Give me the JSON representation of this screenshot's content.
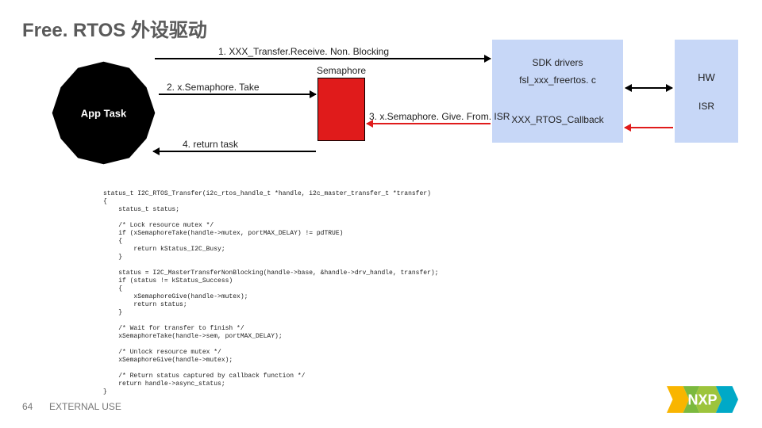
{
  "title": "Free. RTOS 外设驱动",
  "appTask": "App Task",
  "semaphore": "Semaphore",
  "step1": "1.  XXX_Transfer.Receive. Non. Blocking",
  "step2": "2. x.Semaphore. Take",
  "step3": "3. x.Semaphore. Give. From. ISR",
  "step4": "4. return task",
  "sdk": {
    "line1": "SDK drivers",
    "line2": "fsl_xxx_freertos. c",
    "line3": "XXX_RTOS_Callback"
  },
  "hw": {
    "line1": "HW",
    "line2": "ISR"
  },
  "code": "status_t I2C_RTOS_Transfer(i2c_rtos_handle_t *handle, i2c_master_transfer_t *transfer)\n{\n    status_t status;\n\n    /* Lock resource mutex */\n    if (xSemaphoreTake(handle->mutex, portMAX_DELAY) != pdTRUE)\n    {\n        return kStatus_I2C_Busy;\n    }\n\n    status = I2C_MasterTransferNonBlocking(handle->base, &handle->drv_handle, transfer);\n    if (status != kStatus_Success)\n    {\n        xSemaphoreGive(handle->mutex);\n        return status;\n    }\n\n    /* Wait for transfer to finish */\n    xSemaphoreTake(handle->sem, portMAX_DELAY);\n\n    /* Unlock resource mutex */\n    xSemaphoreGive(handle->mutex);\n\n    /* Return status captured by callback function */\n    return handle->async_status;\n}",
  "footer": {
    "num": "64",
    "ext": "EXTERNAL USE"
  }
}
